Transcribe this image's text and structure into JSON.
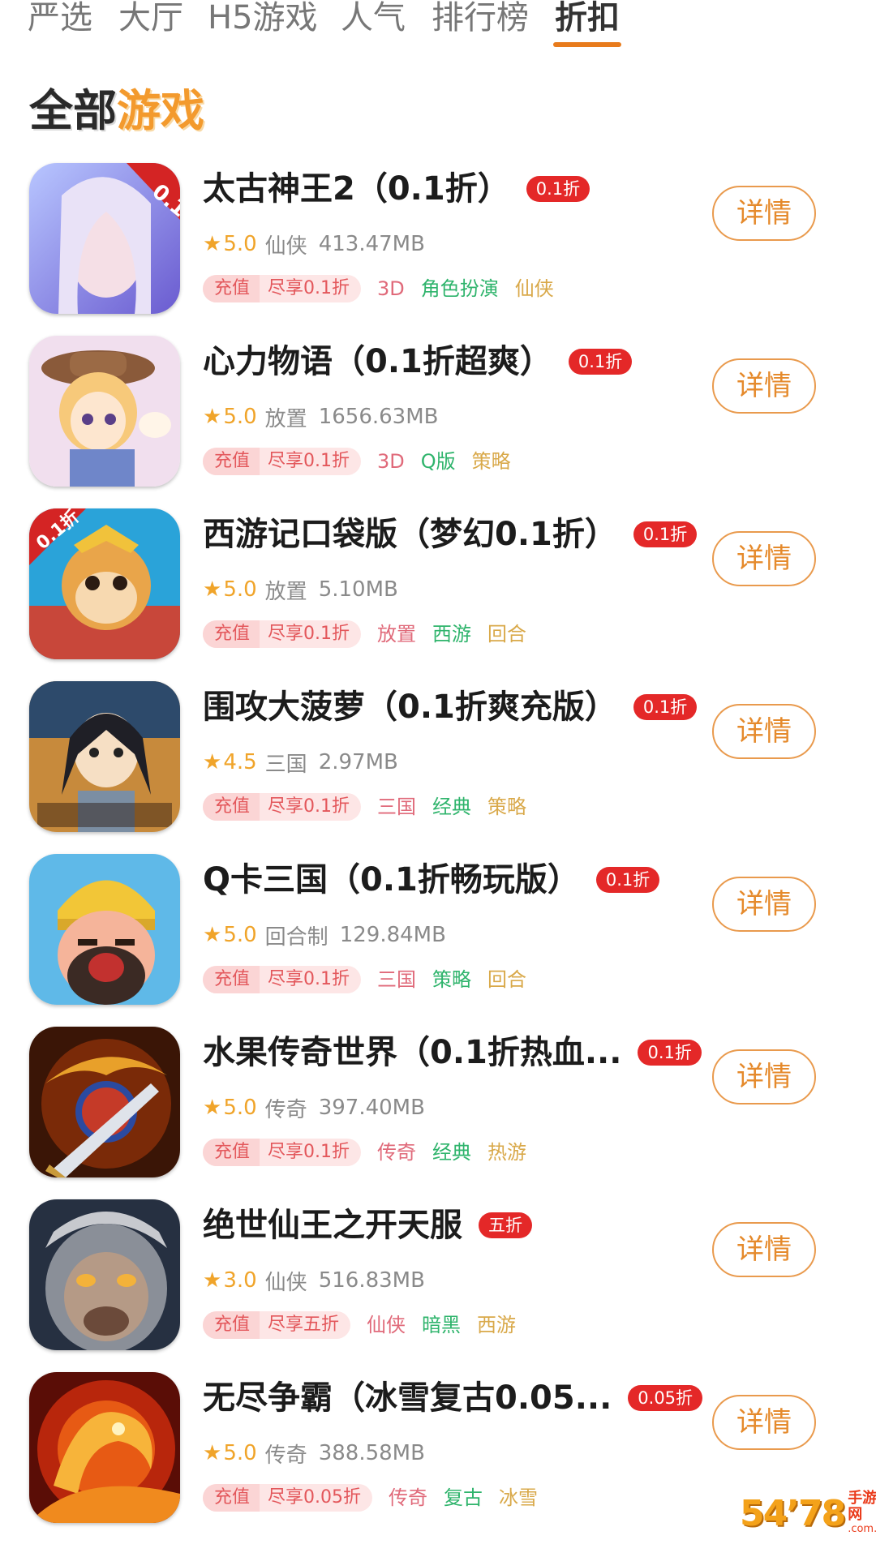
{
  "tabs": [
    {
      "label": "严选",
      "active": false
    },
    {
      "label": "大厅",
      "active": false
    },
    {
      "label": "H5游戏",
      "active": false
    },
    {
      "label": "人气",
      "active": false
    },
    {
      "label": "排行榜",
      "active": false
    },
    {
      "label": "折扣",
      "active": true
    }
  ],
  "section": {
    "title_part1": "全部",
    "title_part2": "游戏"
  },
  "colors": {
    "accent": "#e87b1c",
    "badge": "#e42828",
    "rating": "#f0a42a",
    "button_border": "#e99a4d"
  },
  "games": [
    {
      "name": "太古神王2（0.1折）",
      "badge": "0.1折",
      "rating": "5.0",
      "category": "仙侠",
      "size": "413.47MB",
      "recharge_label": "充值",
      "recharge_value": "尽享0.1折",
      "tags": [
        "3D",
        "角色扮演",
        "仙侠"
      ],
      "button": "详情",
      "icon": "fairy-girl-icon"
    },
    {
      "name": "心力物语（0.1折超爽）",
      "badge": "0.1折",
      "rating": "5.0",
      "category": "放置",
      "size": "1656.63MB",
      "recharge_label": "充值",
      "recharge_value": "尽享0.1折",
      "tags": [
        "3D",
        "Q版",
        "策略"
      ],
      "button": "详情",
      "icon": "anime-cowgirl-icon"
    },
    {
      "name": "西游记口袋版（梦幻0.1折）",
      "badge": "0.1折",
      "rating": "5.0",
      "category": "放置",
      "size": "5.10MB",
      "recharge_label": "充值",
      "recharge_value": "尽享0.1折",
      "tags": [
        "放置",
        "西游",
        "回合"
      ],
      "button": "详情",
      "icon": "monkey-king-icon"
    },
    {
      "name": "围攻大菠萝（0.1折爽充版）",
      "badge": "0.1折",
      "rating": "4.5",
      "category": "三国",
      "size": "2.97MB",
      "recharge_label": "充值",
      "recharge_value": "尽享0.1折",
      "tags": [
        "三国",
        "经典",
        "策略"
      ],
      "button": "详情",
      "icon": "warrior-portrait-icon"
    },
    {
      "name": "Q卡三国（0.1折畅玩版）",
      "badge": "0.1折",
      "rating": "5.0",
      "category": "回合制",
      "size": "129.84MB",
      "recharge_label": "充值",
      "recharge_value": "尽享0.1折",
      "tags": [
        "三国",
        "策略",
        "回合"
      ],
      "button": "详情",
      "icon": "angry-general-icon"
    },
    {
      "name": "水果传奇世界（0.1折热血...",
      "badge": "0.1折",
      "rating": "5.0",
      "category": "传奇",
      "size": "397.40MB",
      "recharge_label": "充值",
      "recharge_value": "尽享0.1折",
      "tags": [
        "传奇",
        "经典",
        "热游"
      ],
      "button": "详情",
      "icon": "dragon-sword-icon"
    },
    {
      "name": "绝世仙王之开天服",
      "badge": "五折",
      "rating": "3.0",
      "category": "仙侠",
      "size": "516.83MB",
      "recharge_label": "充值",
      "recharge_value": "尽享五折",
      "tags": [
        "仙侠",
        "暗黑",
        "西游"
      ],
      "button": "详情",
      "icon": "ape-warrior-icon"
    },
    {
      "name": "无尽争霸（冰雪复古0.05...",
      "badge": "0.05折",
      "rating": "5.0",
      "category": "传奇",
      "size": "388.58MB",
      "recharge_label": "充值",
      "recharge_value": "尽享0.05折",
      "tags": [
        "传奇",
        "复古",
        "冰雪"
      ],
      "button": "详情",
      "icon": "fire-dragon-icon"
    }
  ],
  "watermark": {
    "number": "54’78",
    "name": "手游网",
    "domain": ".com.cn"
  }
}
